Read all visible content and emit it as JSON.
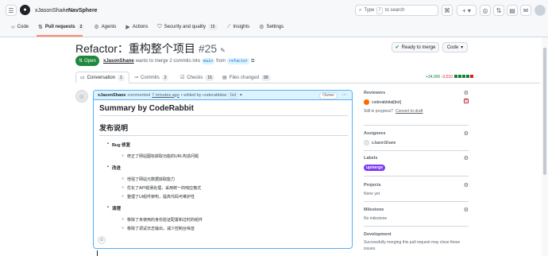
{
  "header": {
    "owner": "xJasonShane",
    "separator": "/",
    "repo": "NavSphere",
    "search_prefix": "Type",
    "search_key": "/",
    "search_suffix": "to search",
    "tabs": [
      {
        "label": "Code",
        "icon": "code-icon"
      },
      {
        "label": "Pull requests",
        "count": "2",
        "icon": "pull-request-icon"
      },
      {
        "label": "Agents",
        "icon": "agents-icon"
      },
      {
        "label": "Actions",
        "icon": "actions-icon"
      },
      {
        "label": "Security and quality",
        "count": "15",
        "icon": "shield-icon"
      },
      {
        "label": "Insights",
        "icon": "graph-icon"
      },
      {
        "label": "Settings",
        "icon": "gear-icon"
      }
    ]
  },
  "pr": {
    "title": "Refactor：重构整个项目",
    "number": "#25",
    "state": "Open",
    "author": "xJasonShane",
    "meta_text": "wants to merge 2 commits into",
    "base": "main",
    "from_text": "from",
    "head": "refactor",
    "ready_button": "Ready to merge",
    "code_button": "Code",
    "tabs": [
      {
        "label": "Conversation",
        "count": "1"
      },
      {
        "label": "Commits",
        "count": "2"
      },
      {
        "label": "Checks",
        "count": "15"
      },
      {
        "label": "Files changed",
        "count": "99"
      }
    ],
    "additions": "+34,006",
    "deletions": "-3,510"
  },
  "comment": {
    "author": "xJasonShane",
    "action": "commented",
    "time": "7 minutes ago",
    "edited": "• edited by coderabbitai",
    "bot": "bot",
    "role": "Owner",
    "heading": "Summary by CodeRabbit",
    "subheading": "发布说明",
    "sections": [
      {
        "title": "Bug 修复",
        "items": [
          "修正了网站图标获取功能的URL构造问题"
        ]
      },
      {
        "title": "改进",
        "items": [
          "增强了网站元数据获取能力",
          "优化了API错误处理，采用统一的响应格式",
          "整理了UI组件架构，提高代码可维护性"
        ]
      },
      {
        "title": "清理",
        "items": [
          "移除了未使用的身份验证配置和过时的组件",
          "移除了调试日志输出，减少控制台噪音"
        ]
      }
    ]
  },
  "sidebar": {
    "reviewers_title": "Reviewers",
    "reviewer": "coderabbitai[bot]",
    "still_in_progress": "Still in progress?",
    "convert_draft": "Convert to draft",
    "assignees_title": "Assignees",
    "assignee": "xJasonShane",
    "labels_title": "Labels",
    "label": "upmerge",
    "projects_title": "Projects",
    "projects_value": "None yet",
    "milestone_title": "Milestone",
    "milestone_value": "No milestone",
    "development_title": "Development",
    "development_text": "Successfully merging this pull request may close these issues."
  }
}
